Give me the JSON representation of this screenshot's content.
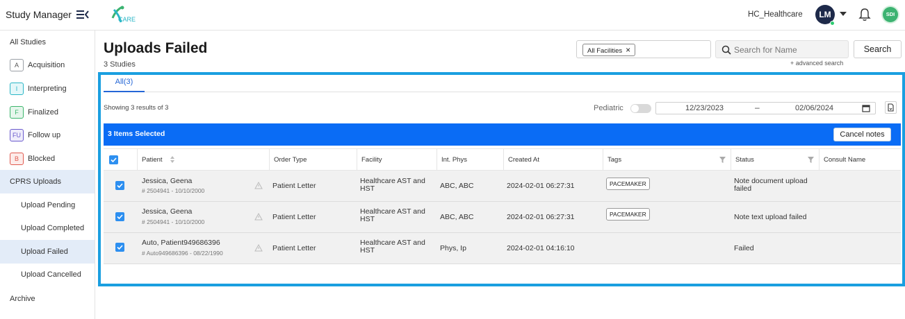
{
  "header": {
    "brand": "Study Manager",
    "logo_text": "CARE",
    "org_name": "HC_Healthcare",
    "avatar_initials": "LM",
    "org_badge": "SDI"
  },
  "sidebar": {
    "items": [
      {
        "label": "All Studies"
      },
      {
        "label": "Acquisition",
        "badge": "A",
        "badge_color": "#9aa0a6",
        "badge_bg": "#ffffff"
      },
      {
        "label": "Interpreting",
        "badge": "I",
        "badge_color": "#29b6c6",
        "badge_bg": "#e4f7f9"
      },
      {
        "label": "Finalized",
        "badge": "F",
        "badge_color": "#3bb56b",
        "badge_bg": "#e6f6ec"
      },
      {
        "label": "Follow up",
        "badge": "FU",
        "badge_color": "#6a5acd",
        "badge_bg": "#efedfb"
      },
      {
        "label": "Blocked",
        "badge": "B",
        "badge_color": "#e05a4f",
        "badge_bg": "#fdecea"
      },
      {
        "label": "CPRS Uploads"
      },
      {
        "label": "Upload Pending"
      },
      {
        "label": "Upload Completed"
      },
      {
        "label": "Upload Failed"
      },
      {
        "label": "Upload Cancelled"
      },
      {
        "label": "Archive"
      }
    ]
  },
  "main": {
    "title": "Uploads Failed",
    "subtitle": "3 Studies",
    "facility_filter": "All Facilities",
    "search_placeholder": "Search for Name",
    "search_button": "Search",
    "advanced_search": "+ advanced search",
    "tab_label": "All(3)",
    "showing_text": "Showing 3 results of 3",
    "pediatric_label": "Pediatric",
    "date_from": "12/23/2023",
    "date_separator": "–",
    "date_to": "02/06/2024",
    "selection_text": "3 Items Selected",
    "cancel_notes": "Cancel notes"
  },
  "table": {
    "columns": [
      "Patient",
      "Order Type",
      "Facility",
      "Int. Phys",
      "Created At",
      "Tags",
      "Status",
      "Consult Name"
    ],
    "rows": [
      {
        "patient": "Jessica, Geena",
        "patient_id": "# 2504941 - 10/10/2000",
        "order_type": "Patient Letter",
        "facility": "Healthcare AST and HST",
        "int_phys": "ABC, ABC",
        "created_at": "2024-02-01 06:27:31",
        "tag": "PACEMAKER",
        "status": "Note document upload failed"
      },
      {
        "patient": "Jessica, Geena",
        "patient_id": "# 2504941 - 10/10/2000",
        "order_type": "Patient Letter",
        "facility": "Healthcare AST and HST",
        "int_phys": "ABC, ABC",
        "created_at": "2024-02-01 06:27:31",
        "tag": "PACEMAKER",
        "status": "Note text upload failed"
      },
      {
        "patient": "Auto, Patient949686396",
        "patient_id": "# Auto949686396 - 08/22/1990",
        "order_type": "Patient Letter",
        "facility": "Healthcare AST and HST",
        "int_phys": "Phys, Ip",
        "created_at": "2024-02-01 04:16:10",
        "tag": "",
        "status": "Failed"
      }
    ]
  },
  "colors": {
    "selection_bar": "#0a6cf5",
    "highlight_frame": "#1a9fe0",
    "active_sidebar": "#e3ecf8",
    "checkbox": "#2d8ff0"
  }
}
